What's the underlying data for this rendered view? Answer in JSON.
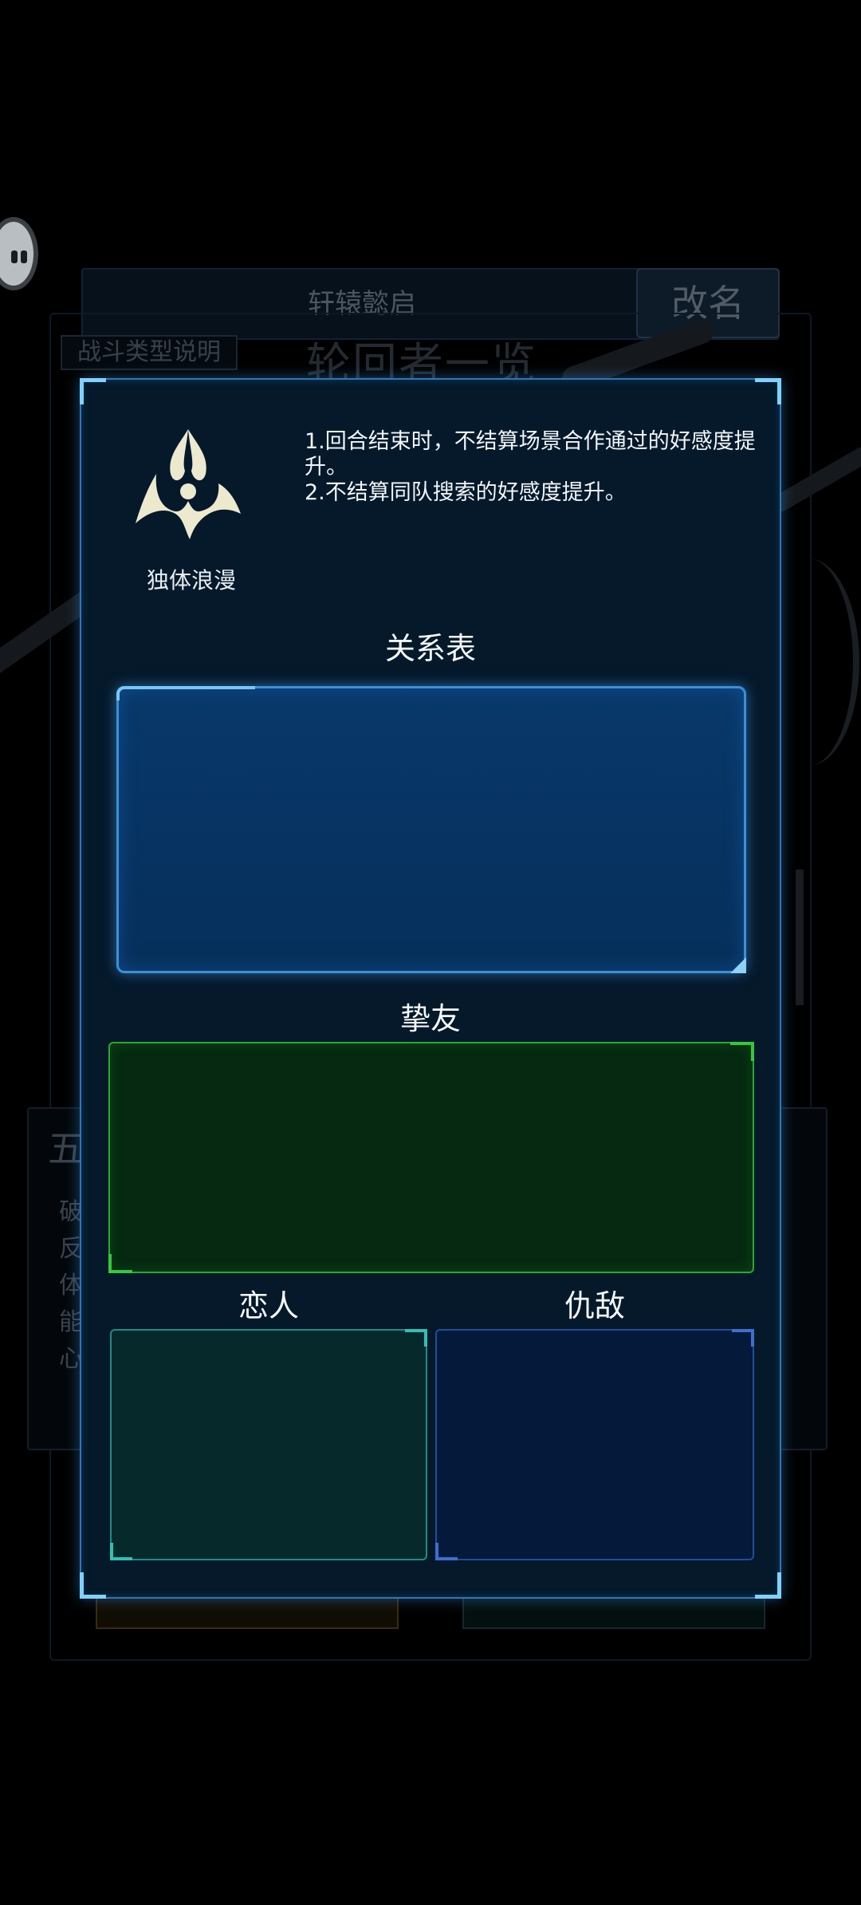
{
  "background": {
    "player_name": "轩辕懿启",
    "rename_button": "改名",
    "battle_type_tab": "战斗类型说明",
    "heading": "轮回者一览",
    "stat_title": "五",
    "stat_items": [
      "破",
      "反",
      "体",
      "能",
      "心"
    ]
  },
  "trait": {
    "icon": "romance-emblem-icon",
    "name": "独体浪漫",
    "description": [
      "1.回合结束时，不结算场景合作通过的好感度提升。",
      "2.不结算同队搜索的好感度提升。"
    ]
  },
  "relations": {
    "title": "关系表",
    "friend_label": "挚友",
    "lover_label": "恋人",
    "enemy_label": "仇敌"
  },
  "colors": {
    "modal_border": "#2a78b9",
    "relation_panel": "#08386a",
    "friend_panel": "#052911",
    "lover_panel": "#062a2c",
    "enemy_panel": "#051a3a"
  }
}
